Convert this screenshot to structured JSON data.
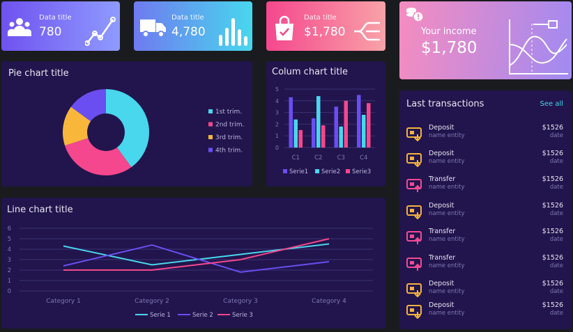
{
  "stats": [
    {
      "label": "Data title",
      "value": "780",
      "icon": "users-icon"
    },
    {
      "label": "Data title",
      "value": "4,780",
      "icon": "truck-icon"
    },
    {
      "label": "Data title",
      "value": "$1,780",
      "icon": "shopping-bag-icon"
    }
  ],
  "income": {
    "label": "Your income",
    "value": "$1,780",
    "icon": "coins-icon"
  },
  "pie": {
    "title": "Pie chart title"
  },
  "column": {
    "title": "Colum chart title"
  },
  "line": {
    "title": "Line chart title"
  },
  "transactions": {
    "title": "Last transactions",
    "see_all": "See all",
    "items": [
      {
        "type": "Deposit",
        "entity": "name entity",
        "amount": "$1526",
        "date": "date",
        "icon": "deposit-icon",
        "color": "#f6b33d"
      },
      {
        "type": "Deposit",
        "entity": "name entity",
        "amount": "$1526",
        "date": "date",
        "icon": "deposit-icon",
        "color": "#f6b33d"
      },
      {
        "type": "Transfer",
        "entity": "name entity",
        "amount": "$1526",
        "date": "date",
        "icon": "transfer-icon",
        "color": "#f54a94"
      },
      {
        "type": "Deposit",
        "entity": "name entity",
        "amount": "$1526",
        "date": "date",
        "icon": "deposit-icon",
        "color": "#f6b33d"
      },
      {
        "type": "Transfer",
        "entity": "name entity",
        "amount": "$1526",
        "date": "date",
        "icon": "transfer-icon",
        "color": "#f54a94"
      },
      {
        "type": "Transfer",
        "entity": "name entity",
        "amount": "$1526",
        "date": "date",
        "icon": "transfer-icon",
        "color": "#f54a94"
      },
      {
        "type": "Deposit",
        "entity": "name entity",
        "amount": "$1526",
        "date": "date",
        "icon": "deposit-icon",
        "color": "#f6b33d"
      },
      {
        "type": "Deposit",
        "entity": "name entity",
        "amount": "$1526",
        "date": "date",
        "icon": "deposit-icon",
        "color": "#f6b33d"
      }
    ]
  },
  "chart_data": [
    {
      "type": "pie",
      "title": "Pie chart title",
      "legend_placement": "right",
      "categories": [
        "1st trim.",
        "2nd trim.",
        "3rd trim.",
        "4th trim."
      ],
      "values": [
        40,
        30,
        15,
        15
      ],
      "colors": [
        "#48d7ed",
        "#f5478d",
        "#f8b73b",
        "#6a4ef2"
      ]
    },
    {
      "type": "bar",
      "title": "Colum chart title",
      "legend_placement": "bottom",
      "categories": [
        "C1",
        "C2",
        "C3",
        "C4"
      ],
      "ylim": [
        0,
        5
      ],
      "yticks": [
        0,
        1,
        2,
        3,
        4,
        5
      ],
      "series": [
        {
          "name": "Serie1",
          "color": "#6a4ef2",
          "values": [
            4.3,
            2.5,
            3.5,
            4.5
          ]
        },
        {
          "name": "Serie2",
          "color": "#48d7ed",
          "values": [
            2.4,
            4.4,
            1.8,
            2.8
          ]
        },
        {
          "name": "Serie3",
          "color": "#f5478d",
          "values": [
            1.5,
            1.9,
            4.0,
            3.8
          ]
        }
      ]
    },
    {
      "type": "line",
      "title": "Line chart title",
      "legend_placement": "bottom",
      "categories": [
        "Category 1",
        "Category 2",
        "Category 3",
        "Category 4"
      ],
      "ylim": [
        0,
        6
      ],
      "yticks": [
        0,
        1,
        2,
        3,
        4,
        5,
        6
      ],
      "series": [
        {
          "name": "Serie 1",
          "color": "#48d7ed",
          "values": [
            4.3,
            2.5,
            3.5,
            4.5
          ]
        },
        {
          "name": "Serie 2",
          "color": "#6a4ef2",
          "values": [
            2.4,
            4.4,
            1.8,
            2.8
          ]
        },
        {
          "name": "Serie 3",
          "color": "#f5478d",
          "values": [
            2,
            2,
            3,
            5
          ]
        }
      ]
    }
  ]
}
